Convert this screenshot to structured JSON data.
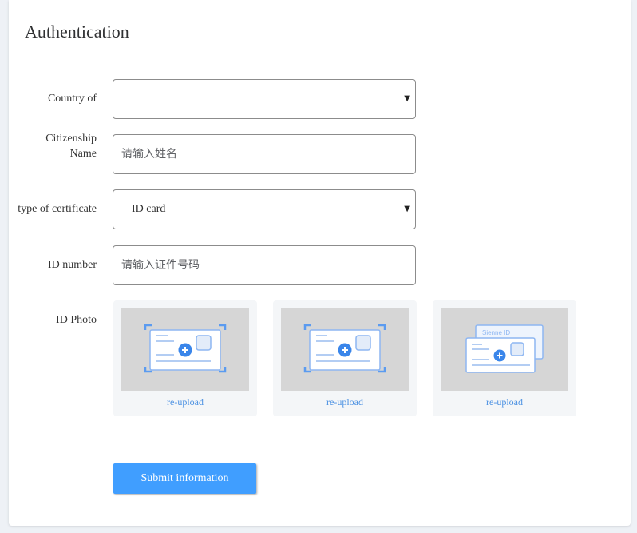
{
  "page": {
    "title": "Authentication"
  },
  "form": {
    "country": {
      "label": "Country of",
      "value": ""
    },
    "name": {
      "label": "Citizenship Name",
      "placeholder": "请输入姓名"
    },
    "cert_type": {
      "label": "type of certificate",
      "value": "ID card"
    },
    "id_number": {
      "label": "ID number",
      "placeholder": "请输入证件号码"
    },
    "photo": {
      "label": "ID Photo",
      "slots": [
        {
          "link": "re-upload",
          "illustration": "id-card-front-icon"
        },
        {
          "link": "re-upload",
          "illustration": "id-card-back-icon"
        },
        {
          "link": "re-upload",
          "illustration": "id-card-sample-icon",
          "card_text": "Sienne ID"
        }
      ]
    },
    "submit_label": "Submit information"
  },
  "colors": {
    "accent": "#409eff",
    "link": "#4a90e2",
    "illustration_blue": "#5b9bf0"
  }
}
